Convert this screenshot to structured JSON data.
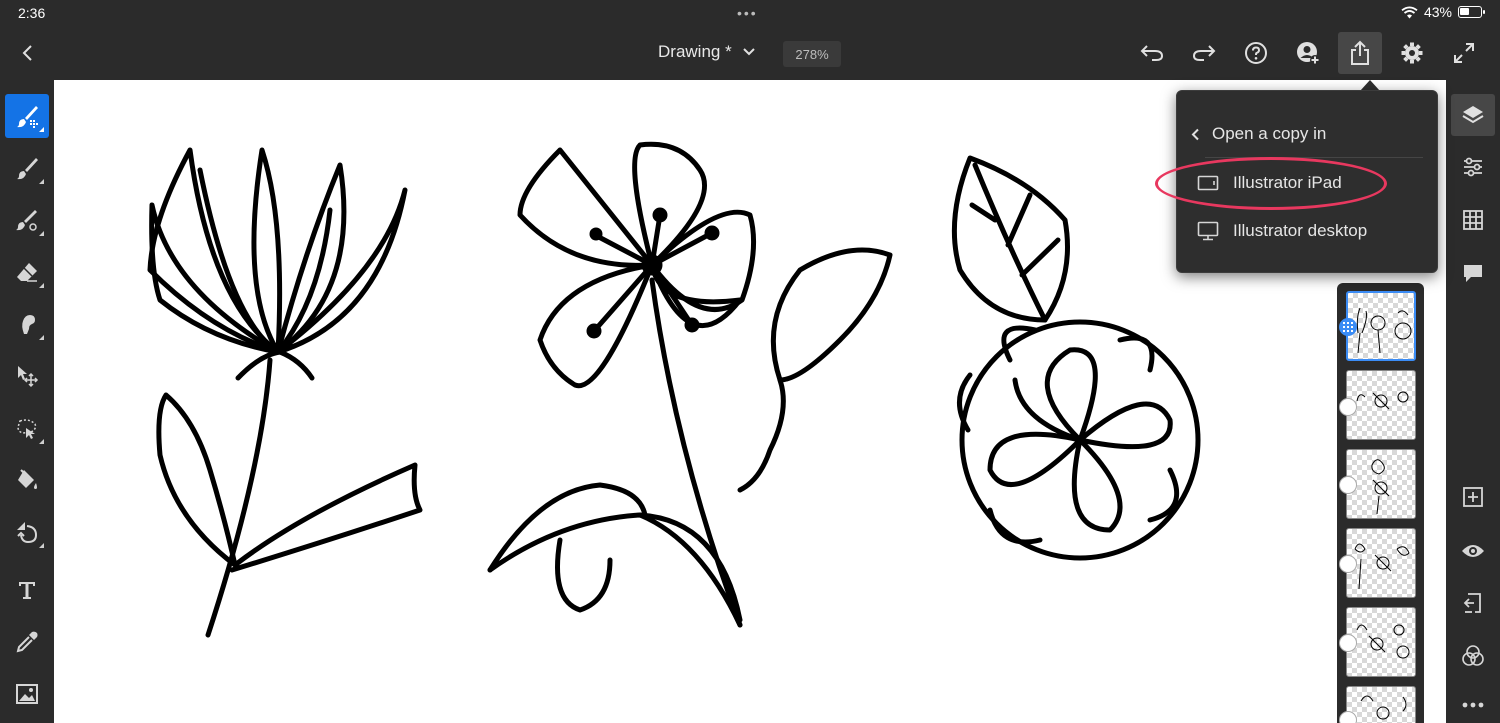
{
  "status_bar": {
    "time": "2:36",
    "dots": "•••",
    "battery_text": "43%"
  },
  "header": {
    "document_title": "Drawing *",
    "zoom": "278%"
  },
  "top_actions": [
    "undo-icon",
    "redo-icon",
    "help-icon",
    "invite-user-icon",
    "share-icon",
    "settings-icon",
    "fullscreen-icon"
  ],
  "left_tools": [
    "brush-tool-active",
    "paintbrush",
    "vector-brush",
    "eraser",
    "smudge",
    "move",
    "lasso-selection",
    "fill",
    "transform",
    "text",
    "eyedropper",
    "place-image"
  ],
  "right_tools": [
    "layers",
    "layer-properties",
    "grid",
    "comments",
    "add-layer",
    "visibility",
    "import",
    "blend-modes",
    "more"
  ],
  "share_menu": {
    "header": "Open a copy in",
    "items": [
      {
        "label": "Illustrator iPad",
        "icon": "tablet-icon",
        "highlighted": true
      },
      {
        "label": "Illustrator desktop",
        "icon": "monitor-icon",
        "highlighted": false
      }
    ]
  },
  "layers": {
    "count_visible": 6,
    "selected_index": 0
  },
  "colors": {
    "accent": "#1473e6",
    "highlight_ring": "#e8385f",
    "toolbar_bg": "#2b2b2b",
    "canvas_bg": "#ffffff"
  }
}
